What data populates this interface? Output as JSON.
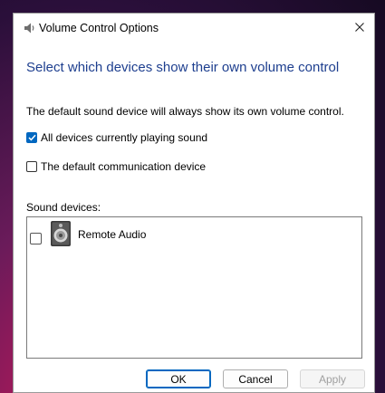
{
  "window": {
    "title": "Volume Control Options",
    "title_icon": "speaker-icon",
    "close_icon": "close-icon"
  },
  "main": {
    "heading": "Select which devices show their own volume control",
    "description": "The default sound device will always show its own volume control.",
    "options": [
      {
        "label": "All devices currently playing sound",
        "checked": true
      },
      {
        "label": "The default communication device",
        "checked": false
      }
    ],
    "devices_label": "Sound devices:",
    "devices": [
      {
        "name": "Remote Audio",
        "checked": false,
        "icon": "speaker-device-icon"
      }
    ]
  },
  "buttons": {
    "ok": "OK",
    "cancel": "Cancel",
    "apply": "Apply",
    "apply_disabled": true
  },
  "colors": {
    "heading": "#1e3f8f",
    "accent": "#0067c0"
  }
}
